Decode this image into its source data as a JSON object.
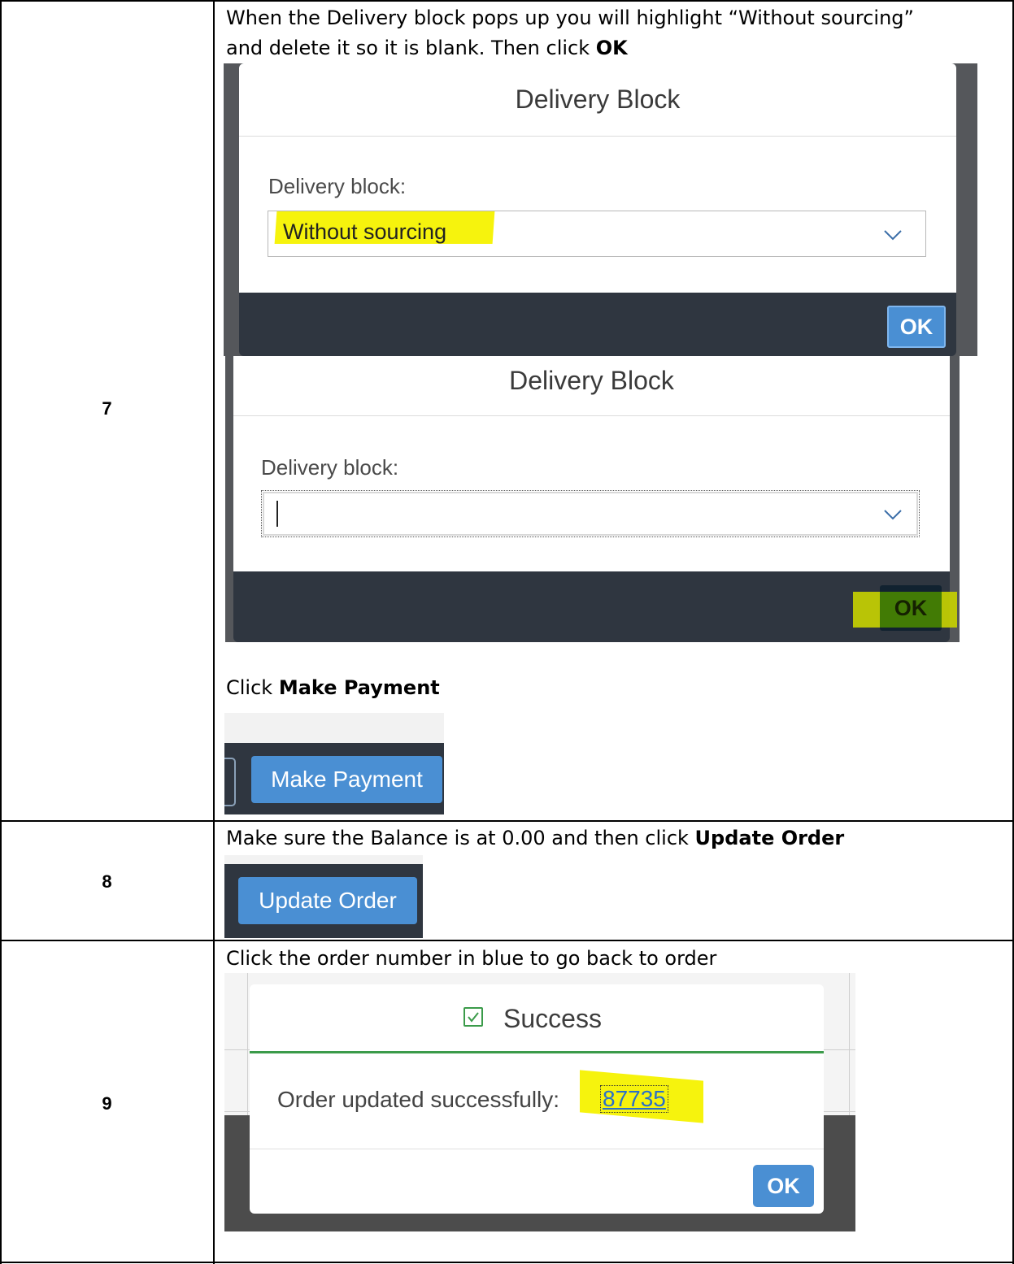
{
  "steps": [
    {
      "number": "7",
      "instruction_pre": "When the Delivery block pops up you will highlight “Without sourcing”",
      "instruction_line2_pre": "and delete it so it is blank. Then click ",
      "instruction_line2_bold": "OK",
      "dialog1": {
        "title": "Delivery Block",
        "label": "Delivery block:",
        "value": "Without sourcing",
        "ok": "OK"
      },
      "dialog2": {
        "title": "Delivery Block",
        "label": "Delivery block:",
        "value": "",
        "ok": "OK"
      },
      "payment_instruction_pre": "Click ",
      "payment_instruction_bold": "Make Payment",
      "payment_button": "Make Payment"
    },
    {
      "number": "8",
      "instruction_pre": "Make sure the Balance is at 0.00 and then click ",
      "instruction_bold": "Update Order",
      "button": "Update Order"
    },
    {
      "number": "9",
      "instruction": "Click the order number in blue to go back to order",
      "dialog": {
        "title": "Success",
        "message": "Order updated successfully:",
        "order_number": "87735",
        "ok": "OK"
      }
    }
  ],
  "colors": {
    "highlight": "#f6f200",
    "dialog_footer": "#2f3640",
    "button_blue": "#4a8fd3",
    "success_green": "#3b9b4a",
    "link_blue": "#2a6fc9"
  }
}
